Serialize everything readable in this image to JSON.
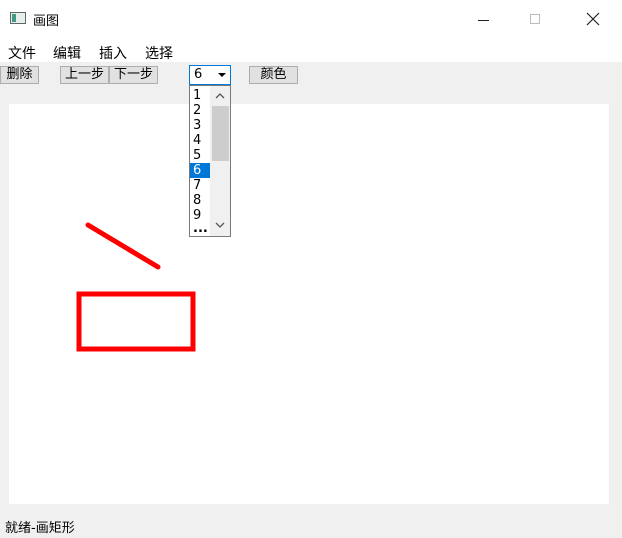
{
  "window": {
    "title": "画图"
  },
  "menu": {
    "file": "文件",
    "edit": "编辑",
    "insert": "插入",
    "select": "选择"
  },
  "toolbar": {
    "delete_label": "删除",
    "prev_label": "上一步",
    "next_label": "下一步",
    "color_label": "颜色",
    "line_width_value": "6",
    "line_width_options": [
      "1",
      "2",
      "3",
      "4",
      "5",
      "6",
      "7",
      "8",
      "9",
      "..."
    ]
  },
  "canvas": {
    "stroke_color": "#ff0000",
    "shapes": [
      "line",
      "rectangle"
    ]
  },
  "status": {
    "text": "就绪-画矩形"
  }
}
